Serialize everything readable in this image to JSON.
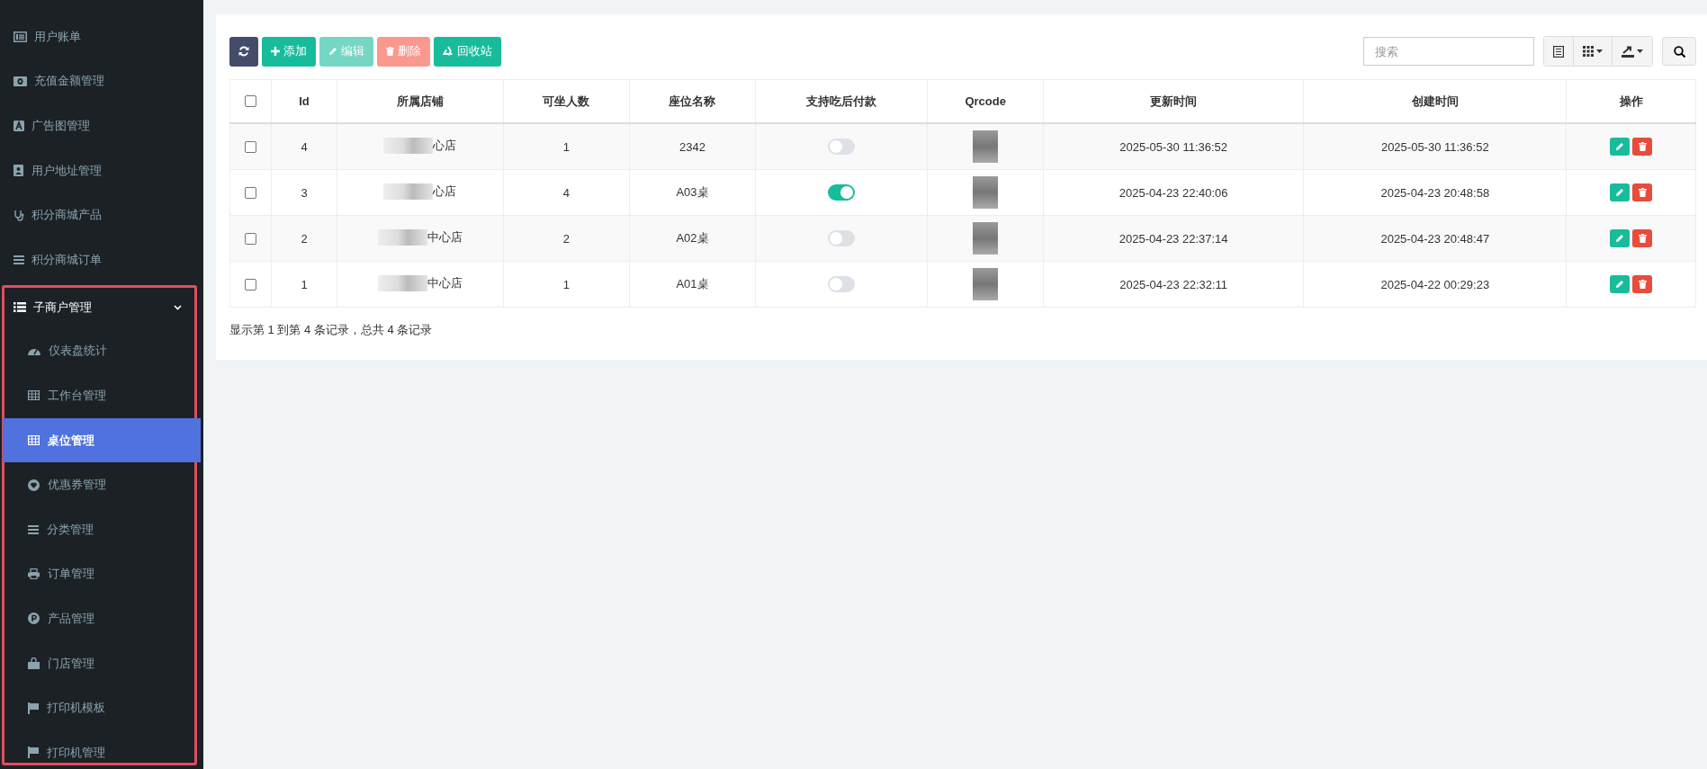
{
  "sidebar": {
    "items": [
      {
        "label": "用户账单",
        "selected": false
      },
      {
        "label": "充值金额管理",
        "selected": false
      },
      {
        "label": "广告图管理",
        "selected": false
      },
      {
        "label": "用户地址管理",
        "selected": false
      },
      {
        "label": "积分商城产品",
        "selected": false
      },
      {
        "label": "积分商城订单",
        "selected": false
      }
    ],
    "group": {
      "label": "子商户管理",
      "expanded": true,
      "highlighted": true,
      "children": [
        {
          "label": "仪表盘统计",
          "selected": false
        },
        {
          "label": "工作台管理",
          "selected": false
        },
        {
          "label": "桌位管理",
          "selected": true
        },
        {
          "label": "优惠券管理",
          "selected": false
        },
        {
          "label": "分类管理",
          "selected": false
        },
        {
          "label": "订单管理",
          "selected": false
        },
        {
          "label": "产品管理",
          "selected": false
        },
        {
          "label": "门店管理",
          "selected": false
        },
        {
          "label": "打印机模板",
          "selected": false
        },
        {
          "label": "打印机管理",
          "selected": false
        }
      ]
    }
  },
  "toolbar": {
    "buttons": [
      {
        "kind": "refresh",
        "disabled": false
      },
      {
        "kind": "add",
        "label": "添加",
        "disabled": false
      },
      {
        "kind": "edit",
        "label": "编辑",
        "disabled": true
      },
      {
        "kind": "delete",
        "label": "删除",
        "disabled": true
      },
      {
        "kind": "recycle",
        "label": "回收站",
        "disabled": false
      }
    ],
    "search": {
      "placeholder": "搜索"
    }
  },
  "table": {
    "select_all": {
      "checked": false
    },
    "columns": [
      "Id",
      "所属店铺",
      "可坐人数",
      "座位名称",
      "支持吃后付款",
      "Qrcode",
      "更新时间",
      "创建时间",
      "操作"
    ],
    "rows": [
      {
        "checked": false,
        "id": "4",
        "shop": "心店",
        "seats": "1",
        "seat_name": "2342",
        "pay_after_eating": false,
        "updated": "2025-05-30 11:36:52",
        "created": "2025-05-30 11:36:52"
      },
      {
        "checked": false,
        "id": "3",
        "shop": "心店",
        "seats": "4",
        "seat_name": "A03桌",
        "pay_after_eating": true,
        "updated": "2025-04-23 22:40:06",
        "created": "2025-04-23 20:48:58"
      },
      {
        "checked": false,
        "id": "2",
        "shop": "中心店",
        "seats": "2",
        "seat_name": "A02桌",
        "pay_after_eating": false,
        "updated": "2025-04-23 22:37:14",
        "created": "2025-04-23 20:48:47"
      },
      {
        "checked": false,
        "id": "1",
        "shop": "中心店",
        "seats": "1",
        "seat_name": "A01桌",
        "pay_after_eating": false,
        "updated": "2025-04-23 22:32:11",
        "created": "2025-04-22 00:29:23"
      }
    ],
    "summary": "显示第 1 到第 4 条记录，总共 4 条记录"
  }
}
